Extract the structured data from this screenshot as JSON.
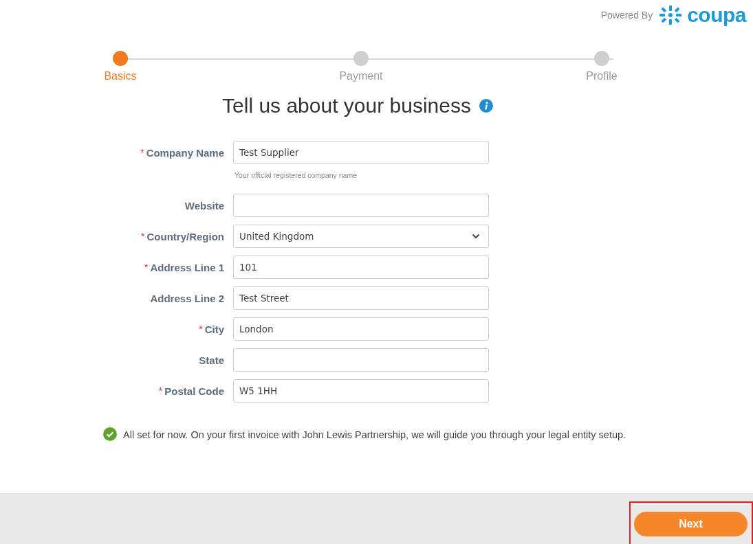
{
  "header": {
    "powered_by": "Powered By",
    "logo_text": "coupa"
  },
  "steps": [
    {
      "label": "Basics",
      "selected": true
    },
    {
      "label": "Payment",
      "selected": false
    },
    {
      "label": "Profile",
      "selected": false
    }
  ],
  "title": "Tell us about your business",
  "fields": [
    {
      "kind": "text",
      "label": "Company Name",
      "marker": "*",
      "value": "Test Supplier",
      "hint": "Your official registered company name"
    },
    {
      "kind": "text",
      "label": "Website"
    },
    {
      "kind": "select",
      "label": "Country/Region",
      "marker": "*",
      "value": "United Kingdom"
    },
    {
      "kind": "text",
      "label": "Address Line 1",
      "marker": "*",
      "value": "101"
    },
    {
      "kind": "text",
      "label": "Address Line 2",
      "value": "Test Street"
    },
    {
      "kind": "text",
      "label": "City",
      "marker": "*",
      "value": "London"
    },
    {
      "kind": "text",
      "label": "State"
    },
    {
      "kind": "text",
      "label": "Postal Code",
      "marker": "*",
      "value": "W5 1HH"
    }
  ],
  "notice": "All set for now. On your first invoice with John Lewis Partnership, we will guide you through your legal entity setup.",
  "footer": {
    "button": "Next",
    "highlighted": true
  }
}
